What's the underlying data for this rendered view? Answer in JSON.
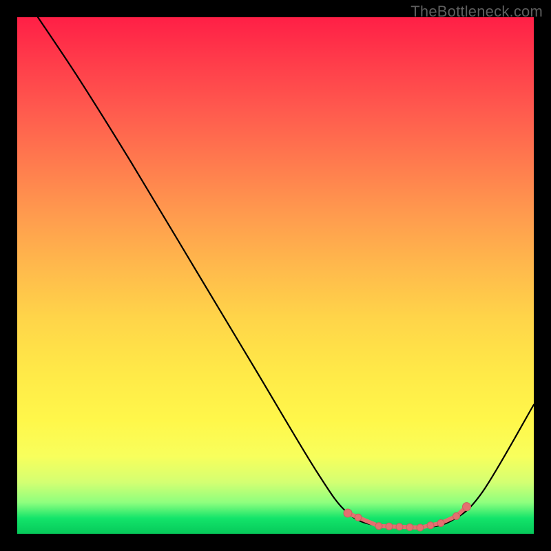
{
  "attribution": "TheBottleneck.com",
  "chart_data": {
    "type": "line",
    "title": "",
    "xlabel": "",
    "ylabel": "",
    "xlim": [
      0,
      100
    ],
    "ylim": [
      0,
      100
    ],
    "grid": false,
    "legend": false,
    "annotations": [],
    "background": "rainbow-vertical-gradient",
    "curve": [
      {
        "x": 4,
        "y": 100
      },
      {
        "x": 12,
        "y": 88
      },
      {
        "x": 22,
        "y": 72
      },
      {
        "x": 34,
        "y": 52
      },
      {
        "x": 46,
        "y": 32
      },
      {
        "x": 58,
        "y": 12
      },
      {
        "x": 64,
        "y": 4
      },
      {
        "x": 70,
        "y": 1.5
      },
      {
        "x": 78,
        "y": 1.2
      },
      {
        "x": 84,
        "y": 2.5
      },
      {
        "x": 90,
        "y": 8
      },
      {
        "x": 100,
        "y": 25
      }
    ],
    "highlight_optimum": {
      "range_x": [
        64,
        87
      ],
      "dots_x": [
        64,
        66,
        70,
        72,
        74,
        76,
        78,
        80,
        82,
        85,
        87
      ],
      "color": "#e47070"
    }
  }
}
